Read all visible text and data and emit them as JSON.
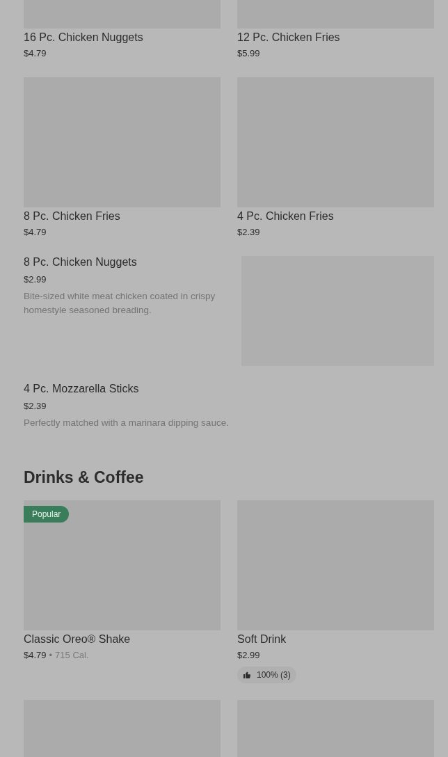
{
  "top_grid": [
    {
      "title": "16 Pc. Chicken Nuggets",
      "price": "$4.79"
    },
    {
      "title": "12 Pc. Chicken Fries",
      "price": "$5.99"
    },
    {
      "title": "8 Pc. Chicken Fries",
      "price": "$4.79"
    },
    {
      "title": "4 Pc. Chicken Fries",
      "price": "$2.39"
    }
  ],
  "list_items": [
    {
      "title": "8 Pc. Chicken Nuggets",
      "price": "$2.99",
      "description": "Bite-sized white meat chicken coated in crispy homestyle seasoned breading.",
      "kind": "picture"
    },
    {
      "title": "4 Pc. Mozzarella Sticks",
      "price": "$2.39",
      "description": "Perfectly matched with a marinara dipping sauce."
    }
  ],
  "section": {
    "title": "Drinks & Coffee",
    "items": [
      {
        "title": "Classic Oreo® Shake",
        "price": "$4.79",
        "separator": "•",
        "calories": "715 Cal.",
        "badge": "Popular"
      },
      {
        "title": "Soft Drink",
        "price": "$2.99",
        "rating": "100% (3)"
      }
    ]
  }
}
